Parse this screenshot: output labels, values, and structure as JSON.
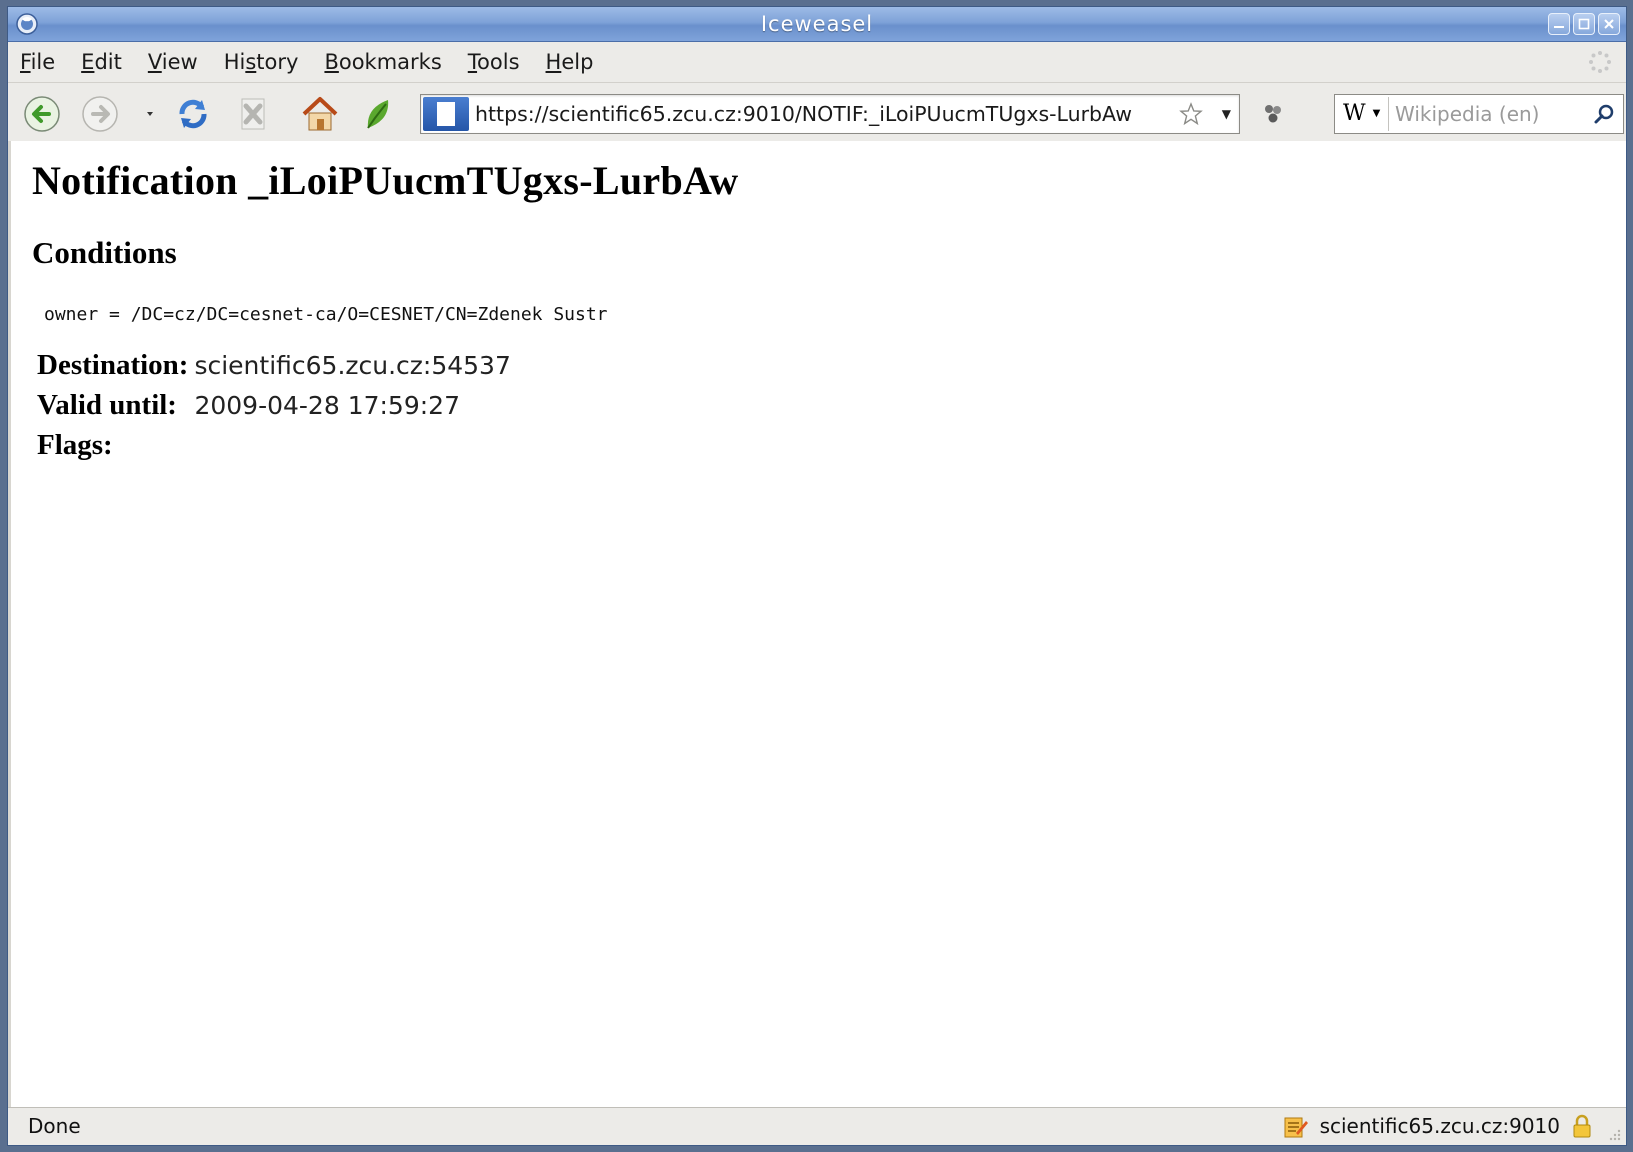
{
  "window": {
    "title": "Iceweasel"
  },
  "menubar": {
    "items": [
      {
        "label": "File",
        "accel": "F",
        "rest": "ile"
      },
      {
        "label": "Edit",
        "accel": "E",
        "rest": "dit"
      },
      {
        "label": "View",
        "accel": "V",
        "rest": "iew"
      },
      {
        "label": "History",
        "pre": "Hi",
        "accel": "s",
        "rest": "tory"
      },
      {
        "label": "Bookmarks",
        "accel": "B",
        "rest": "ookmarks"
      },
      {
        "label": "Tools",
        "accel": "T",
        "rest": "ools"
      },
      {
        "label": "Help",
        "accel": "H",
        "rest": "elp"
      }
    ]
  },
  "navbar": {
    "url": "https://scientific65.zcu.cz:9010/NOTIF:_iLoiPUucmTUgxs-LurbAw",
    "search_engine": "W",
    "search_placeholder": "Wikipedia (en)"
  },
  "page": {
    "title": "Notification _iLoiPUucmTUgxs-LurbAw",
    "conditions_heading": "Conditions",
    "conditions_text": "owner = /DC=cz/DC=cesnet-ca/O=CESNET/CN=Zdenek Sustr",
    "fields": [
      {
        "label": "Destination:",
        "value": "scientific65.zcu.cz:54537"
      },
      {
        "label": "Valid until:",
        "value": "2009-04-28 17:59:27"
      },
      {
        "label": "Flags:",
        "value": ""
      }
    ]
  },
  "statusbar": {
    "text": "Done",
    "host": "scientific65.zcu.cz:9010"
  },
  "colors": {
    "titlebar": "#7ea2d8",
    "window_bg": "#ecebe8",
    "content_bg": "#ffffff",
    "back_arrow": "#3f9a2a"
  }
}
